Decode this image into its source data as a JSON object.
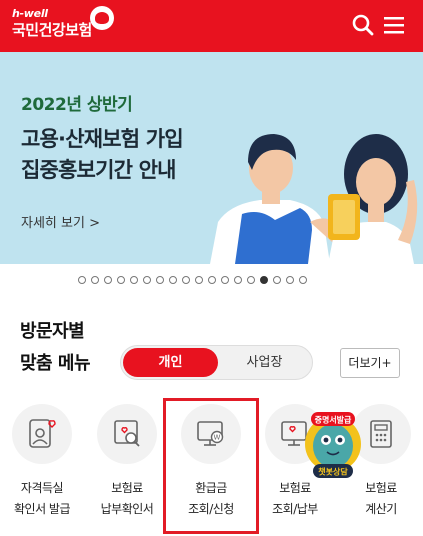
{
  "header": {
    "logo_sub": "h-well",
    "logo_main": "국민건강보험",
    "search_icon": "search-icon",
    "menu_icon": "hamburger-menu-icon",
    "bg_color": "#e8121f"
  },
  "banner": {
    "year": "2022년 상반기",
    "title_line1": "고용·산재보험 가입",
    "title_line2": "집중홍보기간 안내",
    "link": "자세히 보기  >",
    "bg_color": "#bfe3ef"
  },
  "pagination": {
    "total": 18,
    "active_index": 14
  },
  "visitor_menu": {
    "title_line1": "방문자별",
    "title_line2": "맞춤 메뉴",
    "tabs": [
      {
        "label": "개인",
        "active": true
      },
      {
        "label": "사업장",
        "active": false
      }
    ],
    "more": "더보기+"
  },
  "quick_menu": [
    {
      "line1": "자격득실",
      "line2": "확인서 발급",
      "icon": "id-card-heart-icon"
    },
    {
      "line1": "보험료",
      "line2": "납부확인서",
      "icon": "document-search-icon"
    },
    {
      "line1": "환급금",
      "line2": "조회/신청",
      "icon": "refund-monitor-icon"
    },
    {
      "line1": "보험료",
      "line2": "조회/납부",
      "icon": "monitor-heart-icon"
    },
    {
      "line1": "보험료",
      "line2": "계산기",
      "icon": "calculator-icon"
    }
  ],
  "chatbot": {
    "top_text": "증명서발급",
    "bottom_text": "챗봇상담"
  }
}
